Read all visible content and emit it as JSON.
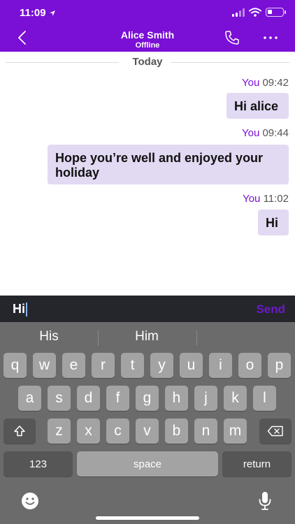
{
  "status_bar": {
    "time": "11:09",
    "battery_level": 0.3
  },
  "header": {
    "contact_name": "Alice Smith",
    "contact_status": "Offline",
    "bg_color": "#7a0fd6"
  },
  "chat": {
    "day_label": "Today",
    "messages": [
      {
        "sender": "You",
        "time": "09:42",
        "text": "Hi alice"
      },
      {
        "sender": "You",
        "time": "09:44",
        "text": "Hope you’re well and enjoyed your holiday"
      },
      {
        "sender": "You",
        "time": "11:02",
        "text": "Hi"
      }
    ]
  },
  "composer": {
    "value": "Hi",
    "send_label": "Send"
  },
  "keyboard": {
    "suggestions": [
      "His",
      "Him"
    ],
    "row1": [
      "q",
      "w",
      "e",
      "r",
      "t",
      "y",
      "u",
      "i",
      "o",
      "p"
    ],
    "row2": [
      "a",
      "s",
      "d",
      "f",
      "g",
      "h",
      "j",
      "k",
      "l"
    ],
    "row3": [
      "z",
      "x",
      "c",
      "v",
      "b",
      "n",
      "m"
    ],
    "numbers_label": "123",
    "space_label": "space",
    "return_label": "return"
  }
}
